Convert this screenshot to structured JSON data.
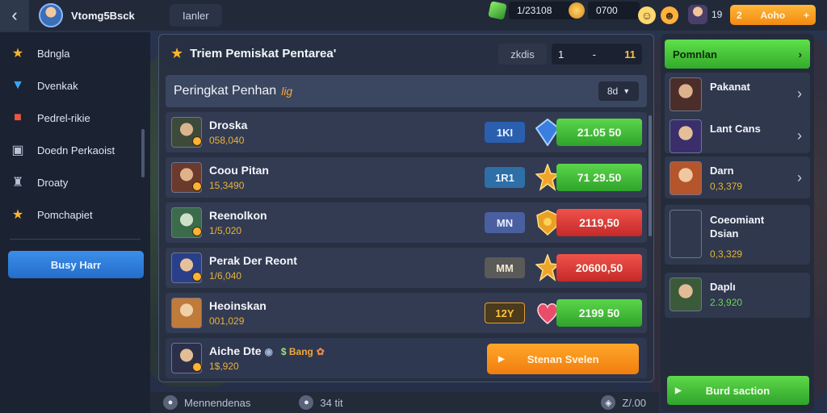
{
  "topbar": {
    "username": "Vtomg5Bsck",
    "tab_label": "Ianler",
    "gems": "1/23108",
    "coins": "0700",
    "hero_count": "19",
    "level_badge": {
      "left": "2",
      "right": "Aoho"
    }
  },
  "sidebar": {
    "items": [
      {
        "label": "Bdngla",
        "icon": "star-icon"
      },
      {
        "label": "Dvenkak",
        "icon": "shirt-icon"
      },
      {
        "label": "Pedrel-rikie",
        "icon": "gift-icon"
      },
      {
        "label": "Doedn Perkaoist",
        "icon": "chest-icon"
      },
      {
        "label": "Droaty",
        "icon": "cup-icon"
      },
      {
        "label": "Pomchapiet",
        "icon": "star-icon"
      }
    ],
    "cta_label": "Busy Harr"
  },
  "panel": {
    "title": "Triem Pemiskat Pentarea'",
    "header_field": "zkdis",
    "header_page": "1",
    "header_dash": "-",
    "header_pager": "11",
    "subtitle": "Peringkat Penhan",
    "subtitle_accent": "lig",
    "selector": "8d",
    "rows": [
      {
        "name": "Droska",
        "score": "058,040",
        "rank": "1KI",
        "bar": "21.05 50"
      },
      {
        "name": "Coou Pitan",
        "score": "15,3490",
        "rank": "1R1",
        "bar": "71 29.50"
      },
      {
        "name": "Reenolkon",
        "score": "1/5,020",
        "rank": "MN",
        "bar": "2119,50"
      },
      {
        "name": "Perak Der Reont",
        "score": "1/6,040",
        "rank": "MM",
        "bar": "20600,50"
      },
      {
        "name": "Heoinskan",
        "score": "001,029",
        "rank": "12Y",
        "bar": "2199 50"
      }
    ],
    "foot_row": {
      "name": "Aiche Dte",
      "chip": "Bang",
      "score": "1$,920",
      "button": "Stenan Svelen"
    }
  },
  "bottom": {
    "left_label": "Mennendenas",
    "mid_label": "34 tit",
    "right_label": "Z/.00"
  },
  "right_panel": {
    "header": "Pomnlan",
    "items": [
      {
        "name": "Pakanat",
        "score": ""
      },
      {
        "name": "Lant Cans",
        "score": ""
      },
      {
        "name": "Darn",
        "score": "0,3,379"
      },
      {
        "name": "Coeomiant Dsian",
        "score": "0,3,329"
      },
      {
        "name": "Daplı",
        "score": "2.3,920"
      }
    ],
    "footer": "Burd saction"
  },
  "colors": {
    "accent_green": "#3fbf34",
    "accent_orange": "#f28a10",
    "accent_red": "#d03a34",
    "accent_blue": "#2f7bd8"
  }
}
